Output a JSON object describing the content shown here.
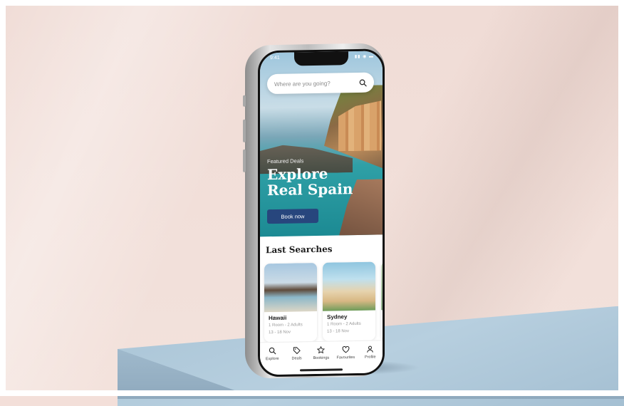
{
  "status": {
    "time": "9:41",
    "icons": "▮▮ ◉ ▬"
  },
  "search": {
    "placeholder": "Where are you going?"
  },
  "hero": {
    "featured_label": "Featured Deals",
    "title_line1": "Explore",
    "title_line2": "Real Spain",
    "cta": "Book now"
  },
  "last_searches": {
    "title": "Last Searches",
    "cards": [
      {
        "name": "Hawaii",
        "line1": "1 Room - 2 Adults",
        "line2": "13 - 18 Nov"
      },
      {
        "name": "Sydney",
        "line1": "1 Room - 2 Adults",
        "line2": "13 - 18 Nov"
      }
    ]
  },
  "tabs": [
    {
      "label": "Explore",
      "icon": "search-icon"
    },
    {
      "label": "Deals",
      "icon": "tag-icon"
    },
    {
      "label": "Bookings",
      "icon": "star-icon"
    },
    {
      "label": "Favourites",
      "icon": "heart-icon"
    },
    {
      "label": "Profile",
      "icon": "user-icon"
    }
  ],
  "colors": {
    "accent": "#27467d",
    "background": "#f3dfd9",
    "pedestal": "#a9c4d6"
  }
}
